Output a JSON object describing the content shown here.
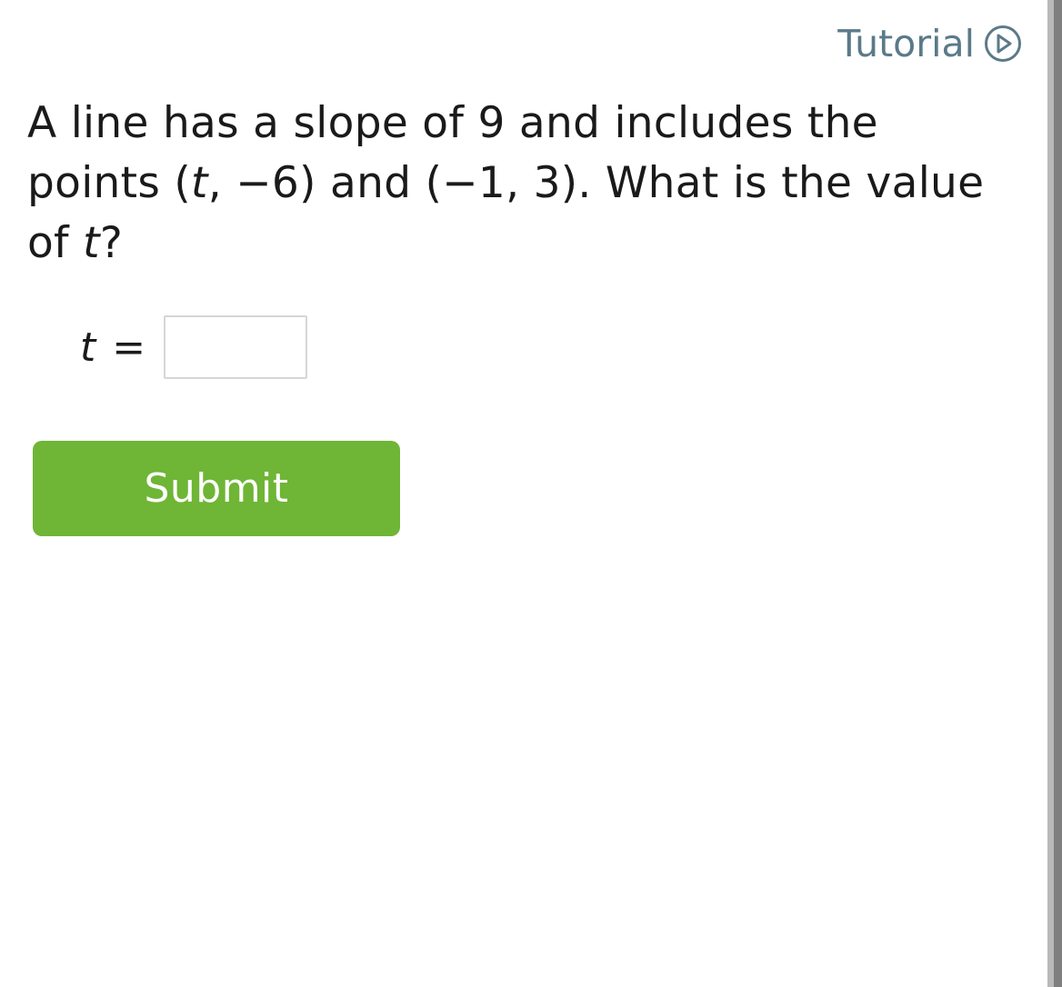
{
  "header": {
    "tutorial_label": "Tutorial",
    "tutorial_icon": "play-circle-icon"
  },
  "question": {
    "part1": "A line has a slope of 9 and includes the points (",
    "var1": "t",
    "part2": ", −6) and (−1, 3). What is the value of ",
    "var2": "t",
    "part3": "?"
  },
  "answer": {
    "variable": "t",
    "equals": "=",
    "value": "",
    "placeholder": ""
  },
  "actions": {
    "submit_label": "Submit"
  },
  "colors": {
    "tutorial": "#5b7a89",
    "submit_bg": "#6fb536",
    "submit_text": "#ffffff",
    "text": "#1a1a1a",
    "input_border": "#d6d6d6"
  }
}
